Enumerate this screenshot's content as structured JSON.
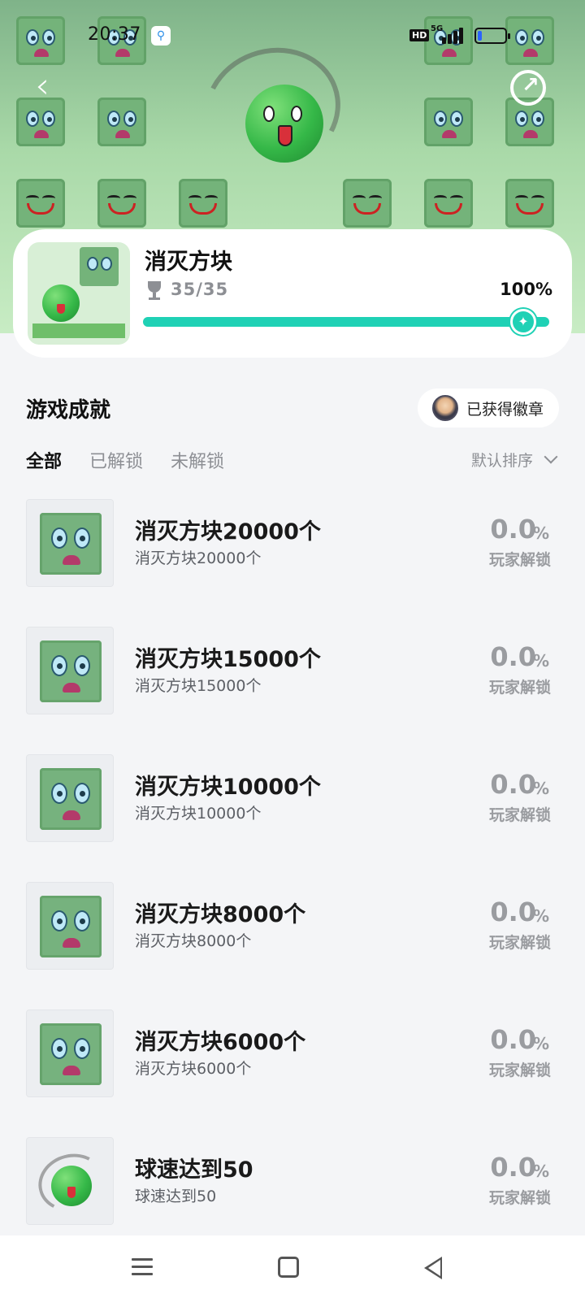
{
  "status_bar": {
    "time": "20:37",
    "network": "5G",
    "hd_label": "HD",
    "battery_level": 0.15
  },
  "header": {
    "back_icon": "chevron-left-icon",
    "share_icon": "share-icon"
  },
  "game": {
    "title": "消灭方块",
    "trophy_count": "35/35",
    "percent": "100%",
    "progress": 1.0
  },
  "section": {
    "title": "游戏成就",
    "badge_label": "已获得徽章"
  },
  "tabs": [
    {
      "label": "全部",
      "active": true
    },
    {
      "label": "已解锁",
      "active": false
    },
    {
      "label": "未解锁",
      "active": false
    }
  ],
  "sort": {
    "label": "默认排序"
  },
  "achievements": [
    {
      "title": "消灭方块20000个",
      "desc": "消灭方块20000个",
      "rate": "0.0",
      "unit": "%",
      "rate_label": "玩家解锁",
      "icon": "block"
    },
    {
      "title": "消灭方块15000个",
      "desc": "消灭方块15000个",
      "rate": "0.0",
      "unit": "%",
      "rate_label": "玩家解锁",
      "icon": "block"
    },
    {
      "title": "消灭方块10000个",
      "desc": "消灭方块10000个",
      "rate": "0.0",
      "unit": "%",
      "rate_label": "玩家解锁",
      "icon": "block"
    },
    {
      "title": "消灭方块8000个",
      "desc": "消灭方块8000个",
      "rate": "0.0",
      "unit": "%",
      "rate_label": "玩家解锁",
      "icon": "block"
    },
    {
      "title": "消灭方块6000个",
      "desc": "消灭方块6000个",
      "rate": "0.0",
      "unit": "%",
      "rate_label": "玩家解锁",
      "icon": "block"
    },
    {
      "title": "球速达到50",
      "desc": "球速达到50",
      "rate": "0.0",
      "unit": "%",
      "rate_label": "玩家解锁",
      "icon": "ball"
    }
  ],
  "nav": {
    "menu_icon": "menu-icon",
    "home_icon": "home-square-icon",
    "back_icon": "back-triangle-icon"
  }
}
